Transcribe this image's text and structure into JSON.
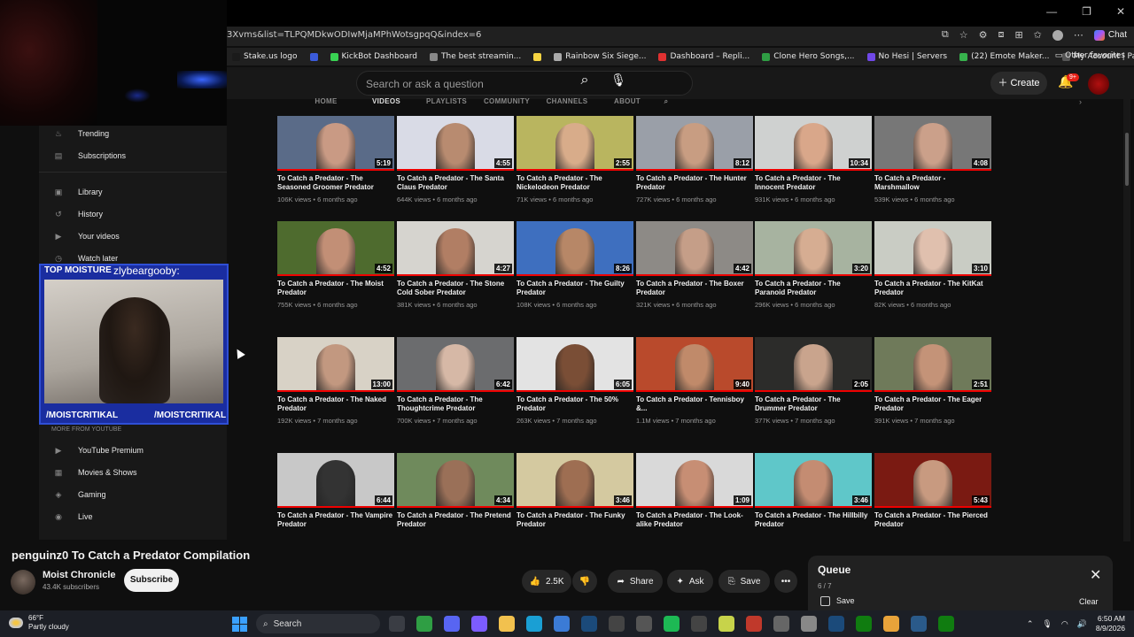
{
  "window": {
    "controls": [
      "—",
      "❐",
      "✕"
    ]
  },
  "browser": {
    "url": "3Xvms&list=TLPQMDkwODIwMjaMPhWotsgpqQ&index=6",
    "chat_label": "Chat",
    "bookmarks": [
      {
        "label": "Stake.us logo",
        "color": "#1a1a1a"
      },
      {
        "label": "",
        "color": "#3b5bdb"
      },
      {
        "label": "KickBot Dashboard",
        "color": "#39d353"
      },
      {
        "label": "The best streamin...",
        "color": "#888"
      },
      {
        "label": "",
        "color": "#f5d442"
      },
      {
        "label": "Rainbow Six Siege...",
        "color": "#aaa"
      },
      {
        "label": "Dashboard – Repli...",
        "color": "#e03131"
      },
      {
        "label": "Clone Hero Songs,...",
        "color": "#2f9e44"
      },
      {
        "label": "No Hesi | Servers",
        "color": "#7048e8"
      },
      {
        "label": "(22) Emote Maker...",
        "color": "#37b24d"
      },
      {
        "label": "My Account | Palm...",
        "color": "#555"
      }
    ],
    "other_favorites": "Other favorites"
  },
  "youtube": {
    "search_placeholder": "Search or ask a question",
    "create_label": "Create",
    "notif_count": "9+",
    "tabs": [
      "HOME",
      "VIDEOS",
      "PLAYLISTS",
      "COMMUNITY",
      "CHANNELS",
      "ABOUT"
    ],
    "sidebar": [
      {
        "label": "Trending",
        "icon": "fire-icon"
      },
      {
        "label": "Subscriptions",
        "icon": "subscriptions-icon"
      },
      {
        "label": "Library",
        "icon": "library-icon"
      },
      {
        "label": "History",
        "icon": "history-icon"
      },
      {
        "label": "Your videos",
        "icon": "your-videos-icon"
      },
      {
        "label": "Watch later",
        "icon": "clock-icon"
      },
      {
        "label": "YouTube Premium",
        "icon": "youtube-icon"
      },
      {
        "label": "Movies & Shows",
        "icon": "film-icon"
      },
      {
        "label": "Gaming",
        "icon": "gaming-icon"
      },
      {
        "label": "Live",
        "icon": "live-icon"
      }
    ],
    "more_from_youtube": "MORE FROM YOUTUBE",
    "videos": [
      {
        "title": "To Catch a Predator - The Seasoned Groomer Predator",
        "meta": "106K views • 6 months ago",
        "duration": "5:19",
        "bg": "#5a6b88",
        "face": "#c99a84"
      },
      {
        "title": "To Catch a Predator - The Santa Claus Predator",
        "meta": "644K views • 6 months ago",
        "duration": "4:55",
        "bg": "#d9dbe6",
        "face": "#b88b70"
      },
      {
        "title": "To Catch a Predator - The Nickelodeon Predator",
        "meta": "71K views • 6 months ago",
        "duration": "2:55",
        "bg": "#b9b55f",
        "face": "#d8ac8a"
      },
      {
        "title": "To Catch a Predator - The Hunter Predator",
        "meta": "727K views • 6 months ago",
        "duration": "8:12",
        "bg": "#9a9fa8",
        "face": "#c89d82"
      },
      {
        "title": "To Catch a Predator - The Innocent Predator",
        "meta": "931K views • 6 months ago",
        "duration": "10:34",
        "bg": "#cfd1d0",
        "face": "#d9a78a"
      },
      {
        "title": "To Catch a Predator - Marshmallow",
        "meta": "539K views • 6 months ago",
        "duration": "4:08",
        "bg": "#777",
        "face": "#cba08a"
      },
      {
        "title": "To Catch a Predator - The Moist Predator",
        "meta": "755K views • 6 months ago",
        "duration": "4:52",
        "bg": "#4e6b2e",
        "face": "#c28f76"
      },
      {
        "title": "To Catch a Predator - The Stone Cold Sober Predator",
        "meta": "381K views • 6 months ago",
        "duration": "4:27",
        "bg": "#d6d4cf",
        "face": "#b17e64"
      },
      {
        "title": "To Catch a Predator - The Guilty Predator",
        "meta": "108K views • 6 months ago",
        "duration": "8:26",
        "bg": "#3e6fbf",
        "face": "#b78767"
      },
      {
        "title": "To Catch a Predator - The Boxer Predator",
        "meta": "321K views • 6 months ago",
        "duration": "4:42",
        "bg": "#8d8a86",
        "face": "#c59e88"
      },
      {
        "title": "To Catch a Predator - The Paranoid Predator",
        "meta": "296K views • 6 months ago",
        "duration": "3:20",
        "bg": "#a7b3a0",
        "face": "#d6ad92"
      },
      {
        "title": "To Catch a Predator - The KitKat Predator",
        "meta": "82K views • 6 months ago",
        "duration": "3:10",
        "bg": "#c9ccc4",
        "face": "#e0c0ae"
      },
      {
        "title": "To Catch a Predator - The Naked Predator",
        "meta": "192K views • 7 months ago",
        "duration": "13:00",
        "bg": "#d8d2c6",
        "face": "#c29880"
      },
      {
        "title": "To Catch a Predator - The Thoughtcrime Predator",
        "meta": "700K views • 7 months ago",
        "duration": "6:42",
        "bg": "#6b6c6e",
        "face": "#d6b8a6"
      },
      {
        "title": "To Catch a Predator - The 50% Predator",
        "meta": "263K views • 7 months ago",
        "duration": "6:05",
        "bg": "#e3e3e3",
        "face": "#7a4e36"
      },
      {
        "title": "To Catch a Predator - Tennisboy &...",
        "meta": "1.1M views • 7 months ago",
        "duration": "9:40",
        "bg": "#b94a2c",
        "face": "#c08a6a"
      },
      {
        "title": "To Catch a Predator - The Drummer Predator",
        "meta": "377K views • 7 months ago",
        "duration": "2:05",
        "bg": "#2c2c2a",
        "face": "#c9a48d"
      },
      {
        "title": "To Catch a Predator - The Eager Predator",
        "meta": "391K views • 7 months ago",
        "duration": "2:51",
        "bg": "#6f7a5a",
        "face": "#c49378"
      },
      {
        "title": "To Catch a Predator - The Vampire Predator",
        "meta": "",
        "duration": "6:44",
        "bg": "#c8c8c8",
        "face": "#333"
      },
      {
        "title": "To Catch a Predator - The Pretend Predator",
        "meta": "",
        "duration": "4:34",
        "bg": "#6f8a5c",
        "face": "#9a7058"
      },
      {
        "title": "To Catch a Predator - The Funky Predator",
        "meta": "",
        "duration": "3:46",
        "bg": "#d4c9a0",
        "face": "#9e6e52"
      },
      {
        "title": "To Catch a Predator - The Look-alike Predator",
        "meta": "",
        "duration": "1:09",
        "bg": "#d9d9d9",
        "face": "#c78e74"
      },
      {
        "title": "To Catch a Predator - The Hillbilly Predator",
        "meta": "",
        "duration": "3:46",
        "bg": "#5fc7c9",
        "face": "#c48c72"
      },
      {
        "title": "To Catch a Predator - The Pierced Predator",
        "meta": "",
        "duration": "5:43",
        "bg": "#7a1a12",
        "face": "#c89a80"
      }
    ]
  },
  "webcam": {
    "top_left_text": "TOP MOISTURE",
    "top_right_text": "zlybeargooby:",
    "bottom_left_text": "/MOISTCRITIKAL",
    "bottom_right_text": "/MOISTCRITIKAL"
  },
  "player": {
    "title": "penguinz0 To Catch a Predator Compilation",
    "channel_name": "Moist Chronicle",
    "subscribers": "43.4K subscribers",
    "subscribe_label": "Subscribe",
    "likes": "2.5K",
    "share_label": "Share",
    "ask_label": "Ask",
    "save_label": "Save",
    "more_label": "•••"
  },
  "queue": {
    "title": "Queue",
    "count": "6 / 7",
    "save_label": "Save",
    "clear_label": "Clear"
  },
  "taskbar": {
    "temperature": "66°F",
    "condition": "Partly cloudy",
    "search_label": "Search",
    "time": "6:50 AM",
    "date": "8/9/2026",
    "apps": [
      {
        "name": "files-app-icon",
        "color": "#3a3d44"
      },
      {
        "name": "nvidia-icon",
        "color": "#2f9e44"
      },
      {
        "name": "discord-icon",
        "color": "#5865f2"
      },
      {
        "name": "copilot-icon",
        "color": "#7c5cff"
      },
      {
        "name": "folder-icon",
        "color": "#f2c14e"
      },
      {
        "name": "edge-icon",
        "color": "#1a9fd4"
      },
      {
        "name": "store-icon",
        "color": "#3b7bd6"
      },
      {
        "name": "steam-icon",
        "color": "#1b4a7a"
      },
      {
        "name": "obs-icon",
        "color": "#444"
      },
      {
        "name": "settings-icon",
        "color": "#555"
      },
      {
        "name": "spotify-icon",
        "color": "#1db954"
      },
      {
        "name": "4k-icon",
        "color": "#444"
      },
      {
        "name": "b-app-icon",
        "color": "#c7d34a"
      },
      {
        "name": "red-app-icon",
        "color": "#c0392b"
      },
      {
        "name": "p-app-icon",
        "color": "#666"
      },
      {
        "name": "g-app-icon",
        "color": "#888"
      },
      {
        "name": "steam2-icon",
        "color": "#1b4a7a"
      },
      {
        "name": "xbox-icon",
        "color": "#107c10"
      },
      {
        "name": "chrome-icon",
        "color": "#e8a33a"
      },
      {
        "name": "steam3-icon",
        "color": "#2a5a8a"
      },
      {
        "name": "xbox2-icon",
        "color": "#107c10"
      }
    ]
  }
}
